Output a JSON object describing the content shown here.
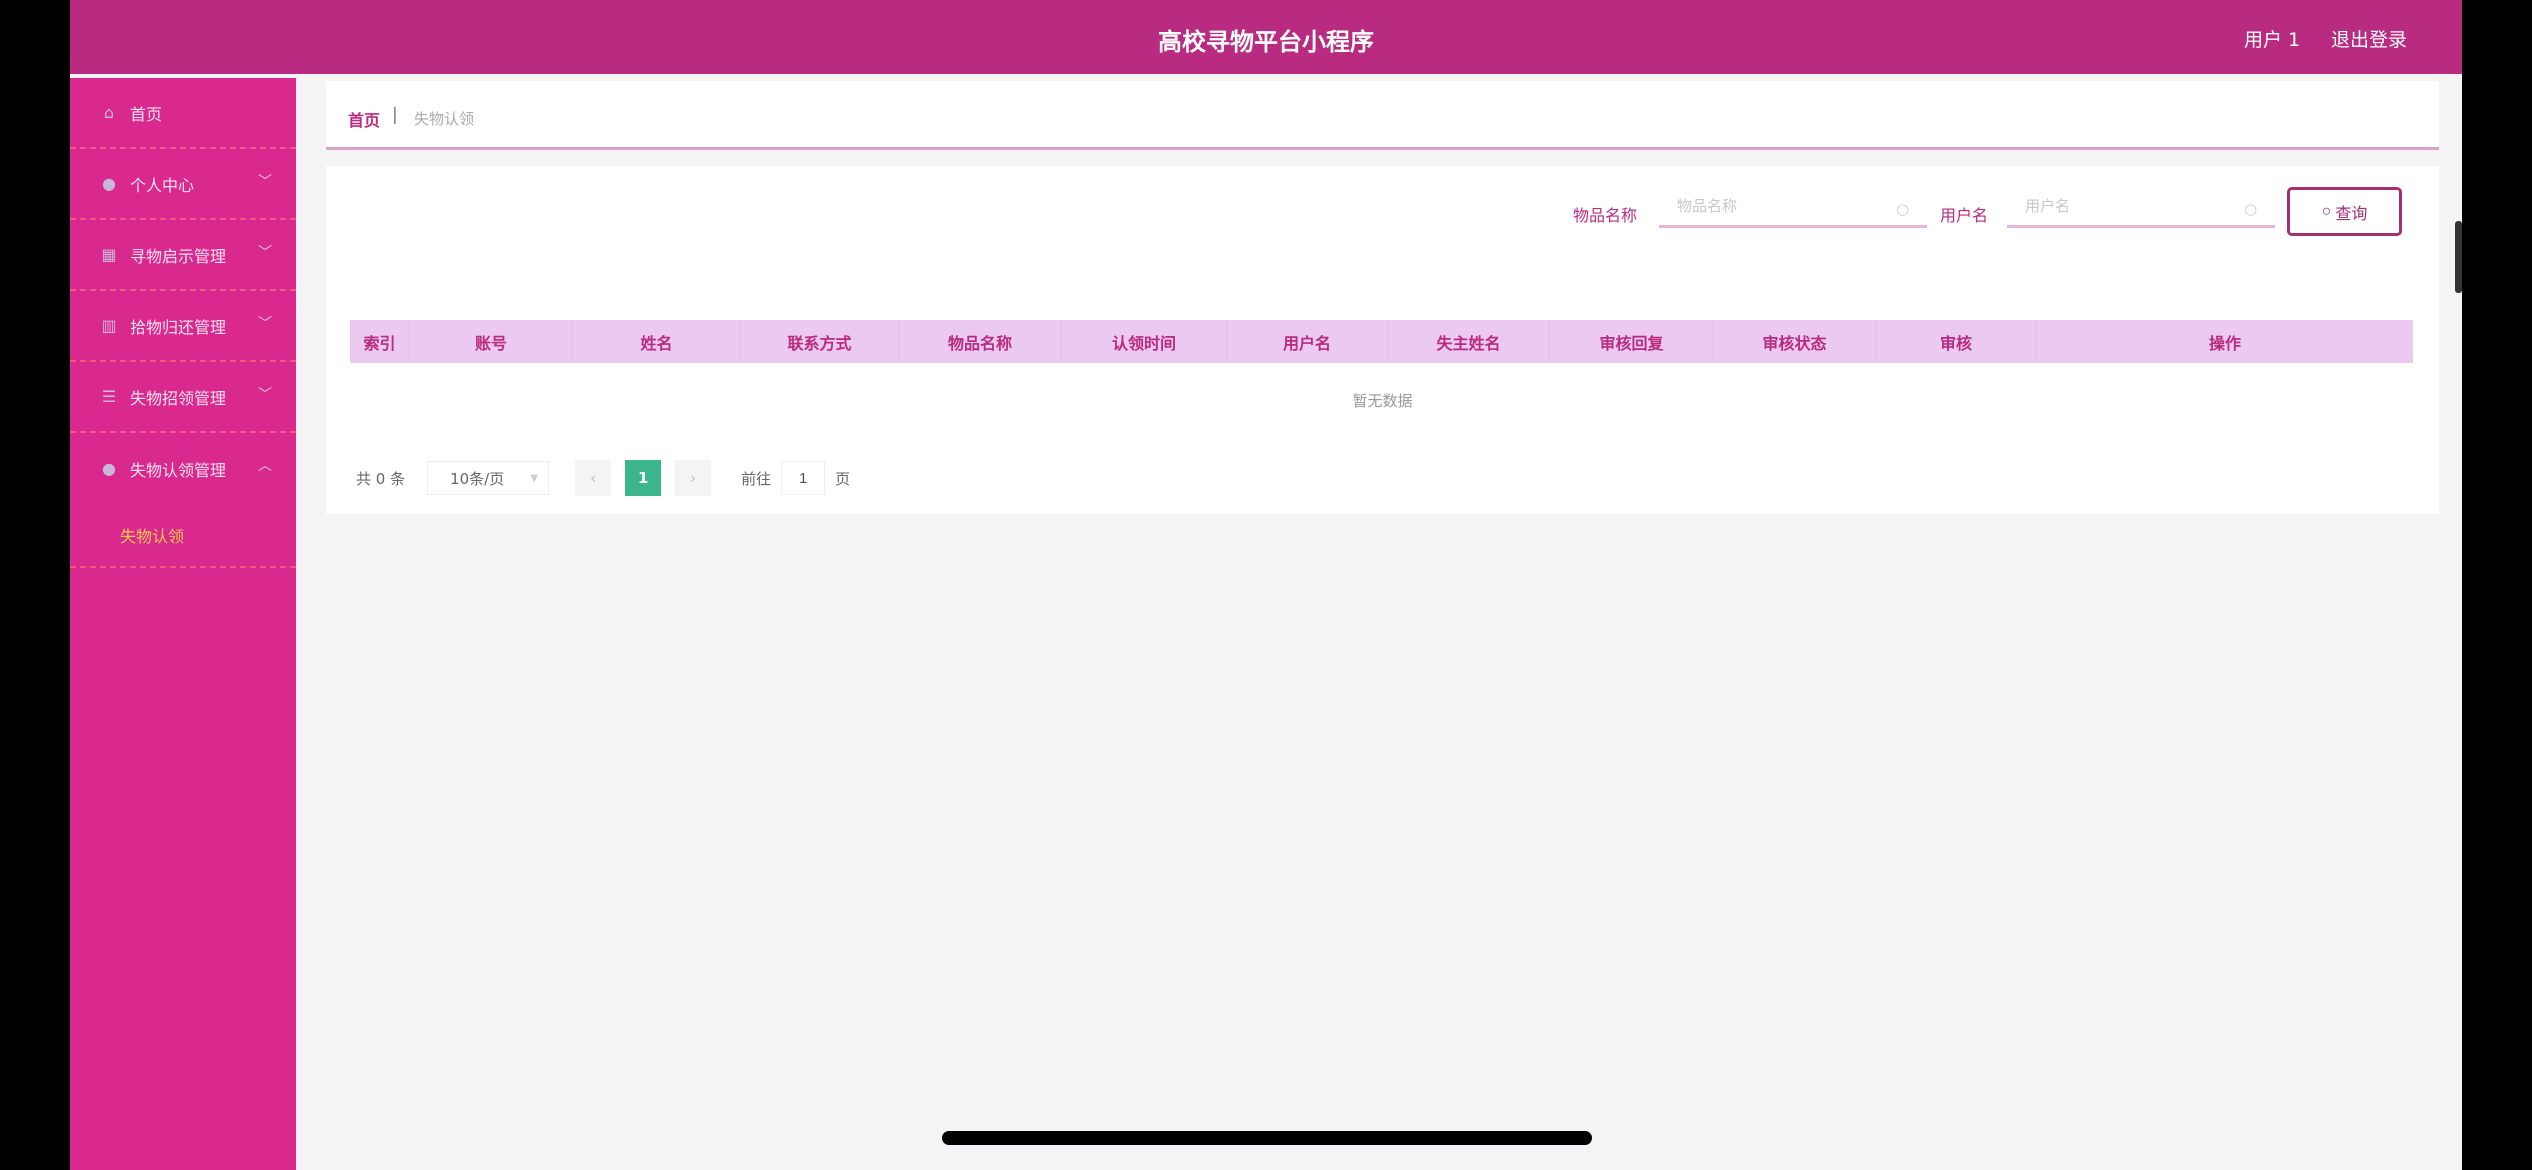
{
  "header": {
    "title": "高校寻物平台小程序",
    "user": "用户 1",
    "logout": "退出登录"
  },
  "sidebar": {
    "items": [
      {
        "label": "首页",
        "icon": "home-icon",
        "expandable": false
      },
      {
        "label": "个人中心",
        "icon": "user-icon",
        "expandable": true
      },
      {
        "label": "寻物启示管理",
        "icon": "grid-icon",
        "expandable": true
      },
      {
        "label": "拾物归还管理",
        "icon": "chart-icon",
        "expandable": true
      },
      {
        "label": "失物招领管理",
        "icon": "list-icon",
        "expandable": true
      },
      {
        "label": "失物认领管理",
        "icon": "user-icon",
        "expandable": true,
        "expanded": true
      }
    ],
    "subitem": "失物认领"
  },
  "breadcrumb": {
    "home": "首页",
    "sep": "|",
    "current": "失物认领"
  },
  "search": {
    "item_label": "物品名称",
    "item_placeholder": "物品名称",
    "user_label": "用户名",
    "user_placeholder": "用户名",
    "button": "查询"
  },
  "table": {
    "columns": [
      "索引",
      "账号",
      "姓名",
      "联系方式",
      "物品名称",
      "认领时间",
      "用户名",
      "失主姓名",
      "审核回复",
      "审核状态",
      "审核",
      "操作"
    ],
    "rows": [],
    "empty": "暂无数据"
  },
  "pagination": {
    "total": "共 0 条",
    "page_size": "10条/页",
    "current_page": "1",
    "goto_label": "前往",
    "goto_value": "1",
    "page_suffix": "页"
  },
  "colors": {
    "header": "#b92b80",
    "sidebar": "#d9288e",
    "table_header": "#ecc9f1",
    "active_page": "#3bb58b",
    "submenu_active": "#f6c94a"
  }
}
